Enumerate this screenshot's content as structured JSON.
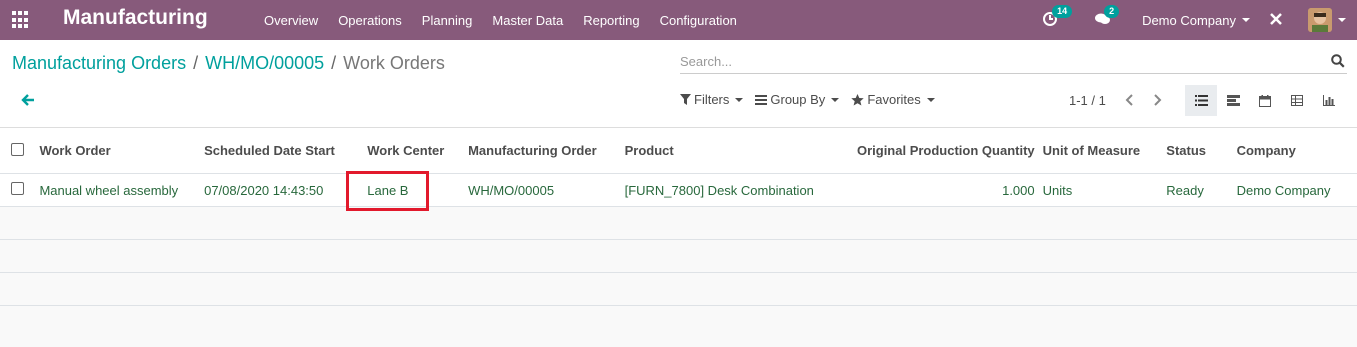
{
  "navbar": {
    "app_name": "Manufacturing",
    "menu": [
      "Overview",
      "Operations",
      "Planning",
      "Master Data",
      "Reporting",
      "Configuration"
    ],
    "activity_count": "14",
    "message_count": "2",
    "company": "Demo Company",
    "bg_color": "#875a7b"
  },
  "breadcrumb": {
    "items": [
      "Manufacturing Orders",
      "WH/MO/00005"
    ],
    "active": "Work Orders",
    "separator": "/"
  },
  "search": {
    "placeholder": "Search..."
  },
  "filters": {
    "filters_label": "Filters",
    "groupby_label": "Group By",
    "favorites_label": "Favorites"
  },
  "pager": {
    "value": "1-1 / 1"
  },
  "table": {
    "columns": [
      "Work Order",
      "Scheduled Date Start",
      "Work Center",
      "Manufacturing Order",
      "Product",
      "Original Production Quantity",
      "Unit of Measure",
      "Status",
      "Company"
    ],
    "rows": [
      {
        "work_order": "Manual wheel assembly",
        "scheduled": "07/08/2020 14:43:50",
        "work_center": "Lane B",
        "mo": "WH/MO/00005",
        "product": "[FURN_7800] Desk Combination",
        "qty": "1.000",
        "uom": "Units",
        "status": "Ready",
        "company": "Demo Company"
      }
    ]
  },
  "colors": {
    "accent": "#00a09d",
    "row_text": "#28683c",
    "highlight": "#e2192c"
  }
}
